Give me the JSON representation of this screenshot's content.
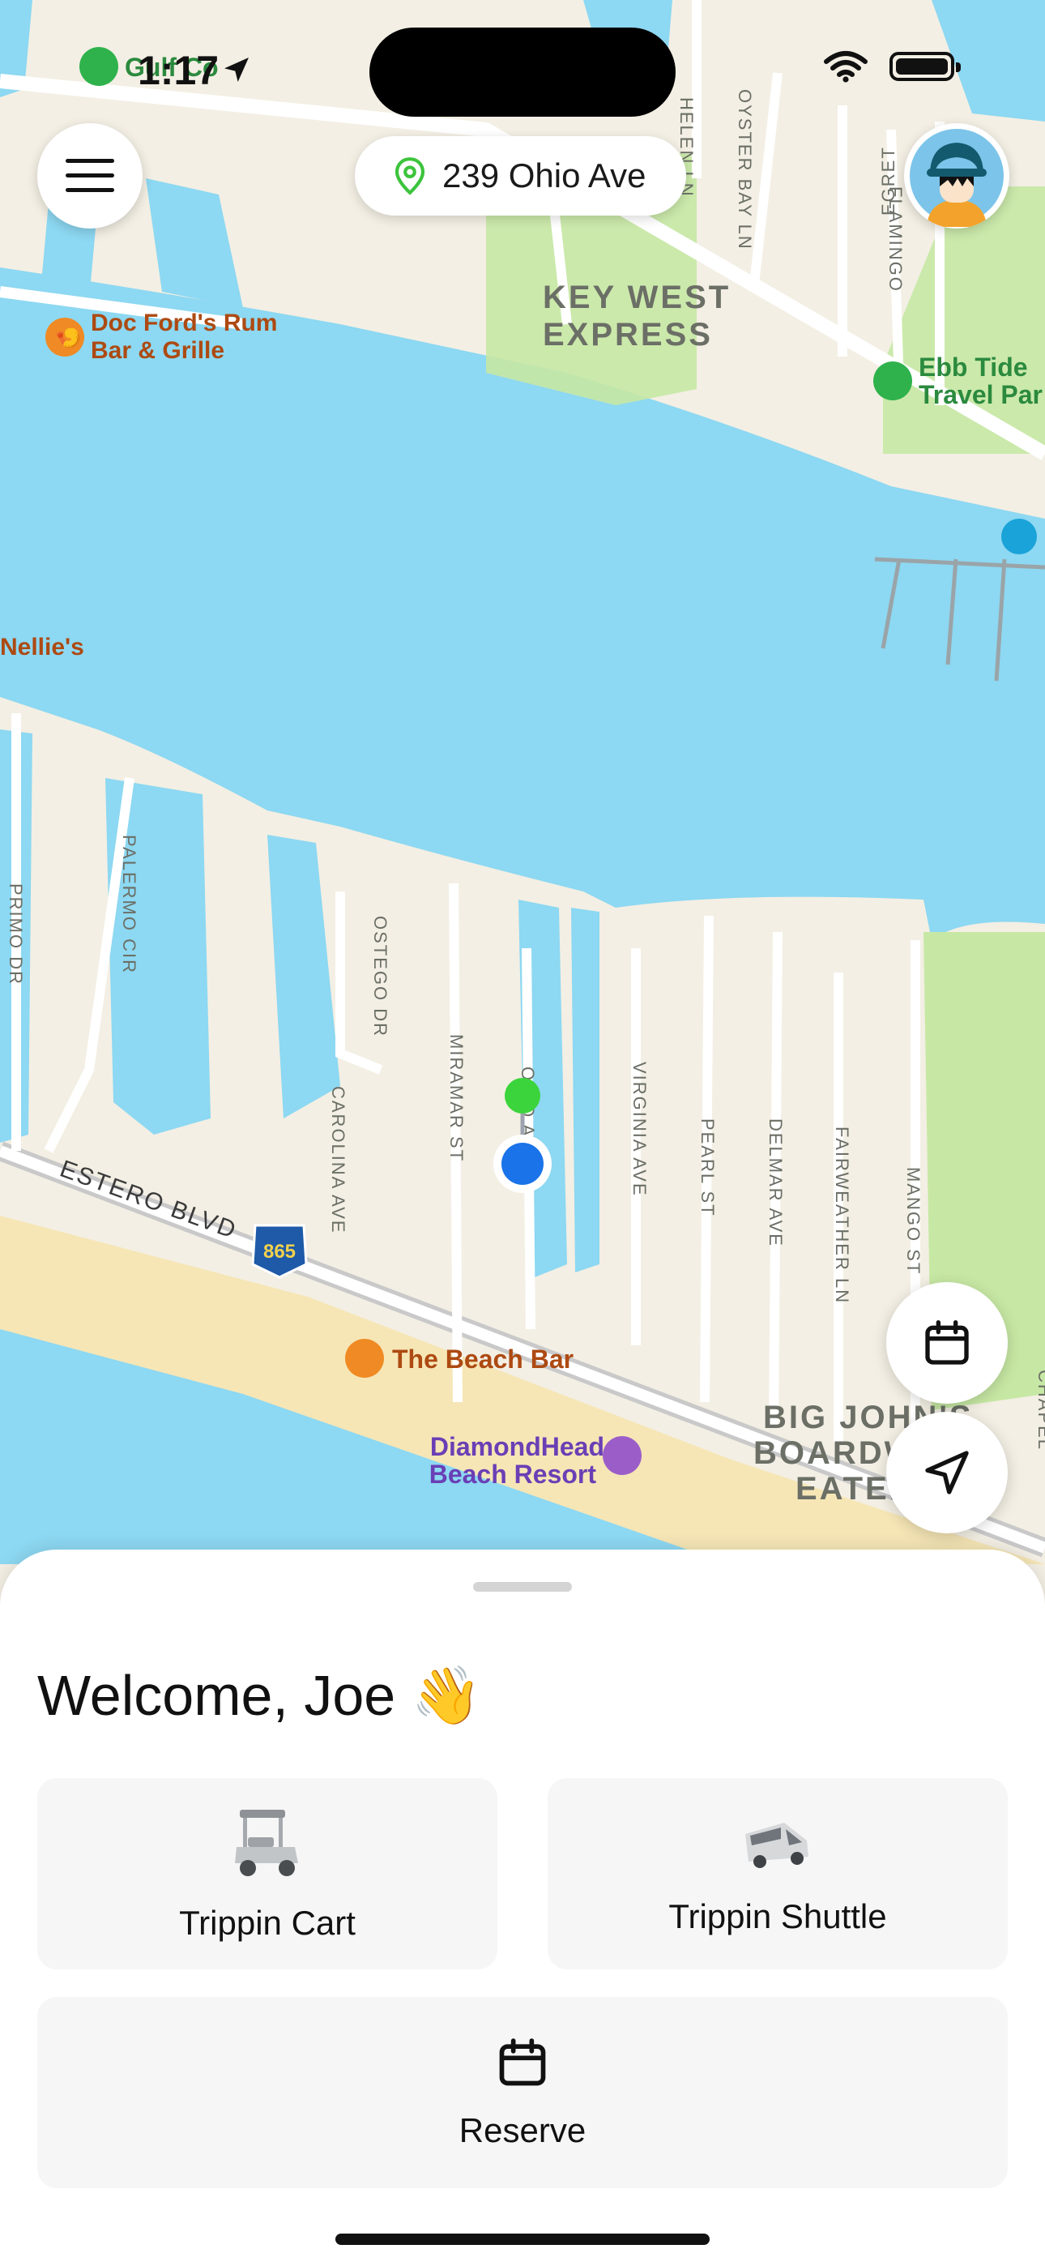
{
  "status_bar": {
    "time": "1:17"
  },
  "header": {
    "address": "239 Ohio Ave"
  },
  "icons": {
    "menu": "hamburger-icon",
    "pin": "location-pin-icon",
    "avatar": "user-avatar",
    "calendar": "calendar-icon",
    "navigate": "navigation-arrow-icon"
  },
  "map": {
    "labels": {
      "doc_fords_1": "Doc Ford's Rum",
      "doc_fords_2": "Bar & Grille",
      "key_west_1": "KEY WEST",
      "key_west_2": "EXPRESS",
      "ebb_tide_1": "Ebb Tide",
      "ebb_tide_2": "Travel Par",
      "nellies": "Nellie's",
      "helen_ln": "HELEN LN",
      "oyster_bay": "OYSTER BAY LN",
      "flamingo": "FLAMINGO",
      "egret": "EGRET",
      "primo": "PRIMO DR",
      "palermo": "PALERMO CIR",
      "ostego": "OSTEGO DR",
      "carolina": "CAROLINA AVE",
      "miramar": "MIRAMAR ST",
      "ohio": "OHIO AVE",
      "virginia": "VIRGINIA AVE",
      "pearl": "PEARL ST",
      "delmar": "DELMAR AVE",
      "fairweather": "FAIRWEATHER LN",
      "mango": "MANGO ST",
      "chapel": "CHAPEL",
      "estero": "ESTERO BLVD",
      "route": "865",
      "beach_bar": "The Beach Bar",
      "diamond_1": "DiamondHead",
      "diamond_2": "Beach Resort",
      "big_johns_1": "BIG JOHN'S",
      "big_johns_2": "BOARDW",
      "big_johns_3": "EATER",
      "gulf_coast": "Gulf Co"
    }
  },
  "sheet": {
    "welcome": "Welcome, Joe 👋",
    "options": [
      {
        "label": "Trippin Cart",
        "icon": "golf-cart-icon"
      },
      {
        "label": "Trippin Shuttle",
        "icon": "shuttle-van-icon"
      },
      {
        "label": "Reserve",
        "icon": "calendar-icon"
      }
    ]
  },
  "colors": {
    "water": "#8dd8f2",
    "land": "#f3efe4",
    "park": "#c7e8a4",
    "sand": "#f6e6b6",
    "user_location": "#1a73e8",
    "destination_pin": "#3cd43c"
  }
}
